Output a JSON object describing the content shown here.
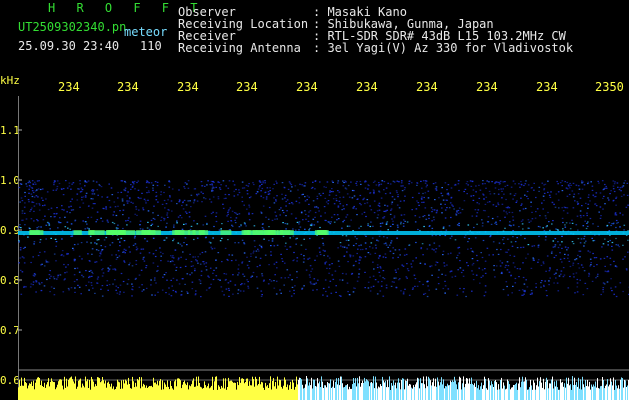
{
  "app": {
    "title": "H R O F F T",
    "file_name": "UT2509302340.pn",
    "type_label": "meteor",
    "date_time": "25.09.30 23:40",
    "count": "110"
  },
  "header": {
    "rows": [
      {
        "key": "Observer",
        "value": ": Masaki Kano"
      },
      {
        "key": "Receiving Location",
        "value": ": Shibukawa, Gunma, Japan"
      },
      {
        "key": "Receiver",
        "value": ": RTL-SDR SDR# 43dB L15 103.2MHz CW"
      },
      {
        "key": "Receiving Antenna",
        "value": ": 3el Yagi(V) Az 330 for Vladivostok"
      }
    ]
  },
  "axes": {
    "y_unit": "kHz",
    "x_ticks": [
      "234",
      "234",
      "234",
      "234",
      "234",
      "234",
      "234",
      "234",
      "234",
      "2350"
    ],
    "y_ticks": [
      "1.1",
      "1.0",
      "0.9",
      "0.8",
      "0.7",
      "0.6"
    ]
  },
  "colors": {
    "background": "#000000",
    "label_green": "#33dd33",
    "label_cyan": "#77ddff",
    "axis_yellow": "#ffff44",
    "signal_band": "#00ccff",
    "noise_blue": "#1a2fd0",
    "amplitude_bars": "#ffff44"
  }
}
